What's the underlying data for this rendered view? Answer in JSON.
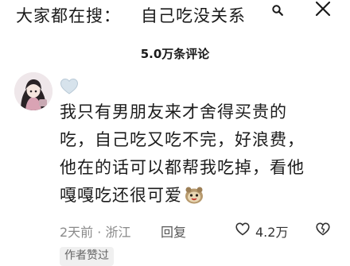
{
  "header": {
    "search_prefix": "大家都在搜：",
    "search_query": "自己吃没关系",
    "search_icon": "search-icon",
    "close_icon": "close-icon"
  },
  "comments_header": {
    "count_label": "5.0万条评论"
  },
  "comment": {
    "avatar": "avatar",
    "badge_icon": "heart-icon",
    "text_lines": [
      "我只有男朋友来才舍得买贵的",
      "吃，自己吃又吃不完，好浪费，",
      "他在的话可以都帮我吃掉，看他",
      "嘎嘎吃还很可爱"
    ],
    "emoji_icon": "cute-face-emoji",
    "time_location": "2天前 · 浙江",
    "reply_label": "回复",
    "like_count": "4.2万",
    "author_badge": "作者赞过",
    "colors": {
      "text": "#1c1c1c",
      "meta": "#8a8a8a",
      "badge_bg": "#f0f0f0"
    }
  }
}
